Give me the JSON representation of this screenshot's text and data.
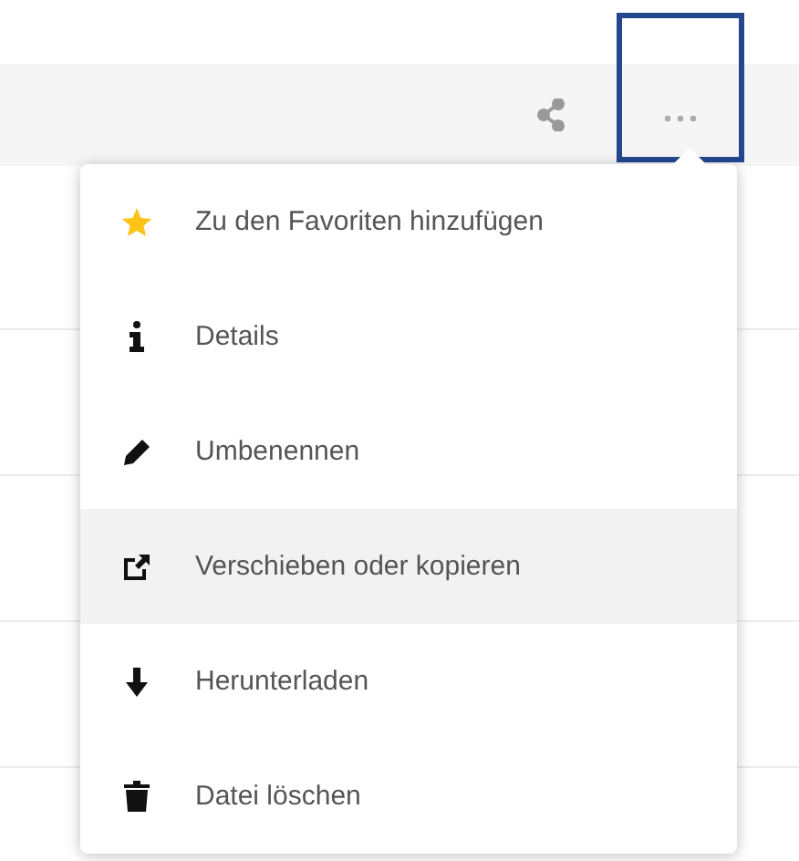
{
  "toolbar": {
    "actions": [
      {
        "kind": "share",
        "highlighted": false
      },
      {
        "kind": "more",
        "highlighted": true
      }
    ]
  },
  "menu": {
    "items": [
      {
        "kind": "star",
        "label": "Zu den Favoriten hinzufügen",
        "hovered": false
      },
      {
        "kind": "info",
        "label": "Details",
        "hovered": false
      },
      {
        "kind": "pencil",
        "label": "Umbenennen",
        "hovered": false
      },
      {
        "kind": "external",
        "label": "Verschieben oder kopieren",
        "hovered": true
      },
      {
        "kind": "download",
        "label": "Herunterladen",
        "hovered": false
      },
      {
        "kind": "trash",
        "label": "Datei löschen",
        "hovered": false
      }
    ]
  }
}
